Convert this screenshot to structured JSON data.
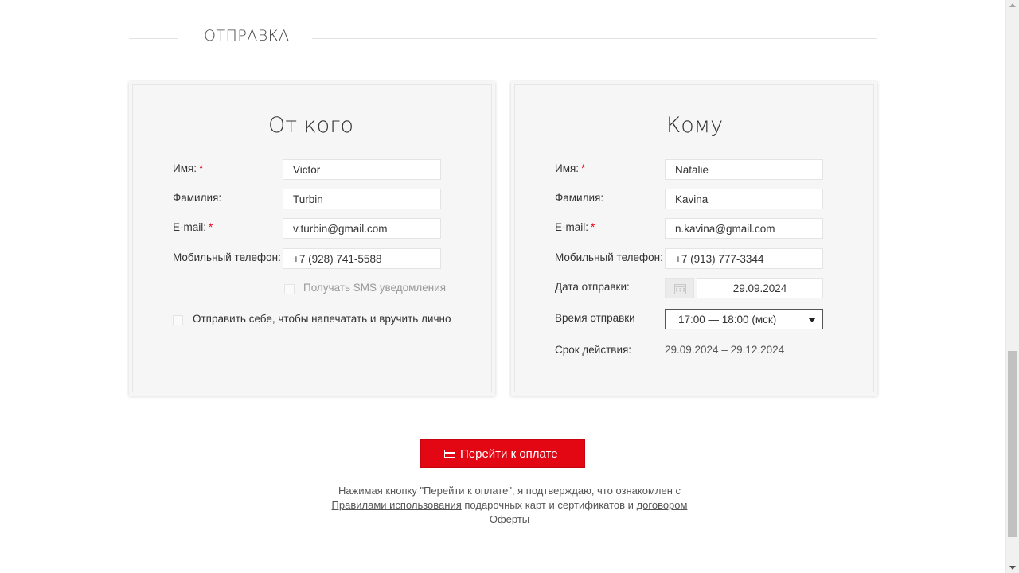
{
  "section": {
    "title": "ОТПРАВКА"
  },
  "from": {
    "title": "От кого",
    "fields": {
      "name": {
        "label": "Имя:",
        "required_mark": "*",
        "value": "Victor"
      },
      "surname": {
        "label": "Фамилия:",
        "value": "Turbin"
      },
      "email": {
        "label": "E-mail:",
        "required_mark": "*",
        "value": "v.turbin@gmail.com"
      },
      "phone": {
        "label": "Мобильный телефон:",
        "value": "+7 (928) 741-5588"
      }
    },
    "sms_label": "Получать SMS уведомления",
    "self_send_label": "Отправить себе, чтобы напечатать и вручить лично"
  },
  "to": {
    "title": "Кому",
    "fields": {
      "name": {
        "label": "Имя:",
        "required_mark": "*",
        "value": "Natalie"
      },
      "surname": {
        "label": "Фамилия:",
        "value": "Kavina"
      },
      "email": {
        "label": "E-mail:",
        "required_mark": "*",
        "value": "n.kavina@gmail.com"
      },
      "phone": {
        "label": "Мобильный телефон:",
        "value": "+7 (913) 777-3344"
      },
      "send_date": {
        "label": "Дата отправки:",
        "value": "29.09.2024",
        "icon": "calendar-icon"
      },
      "send_time": {
        "label": "Время отправки",
        "value": "17:00 — 18:00 (мск)"
      },
      "validity": {
        "label": "Срок действия:",
        "value": "29.09.2024 – 29.12.2024"
      }
    }
  },
  "pay_button": {
    "label": "Перейти к оплате",
    "icon": "card-icon"
  },
  "disclaimer": {
    "text_before": "Нажимая кнопку \"Перейти к оплате\", я подтверждаю, что ознакомлен с",
    "rules_link": "Правилами использования",
    "text_middle": "подарочных карт и сертификатов и",
    "offer_link": "договором Оферты"
  },
  "colors": {
    "accent": "#e30613",
    "card_bg": "#f6f6f6"
  }
}
